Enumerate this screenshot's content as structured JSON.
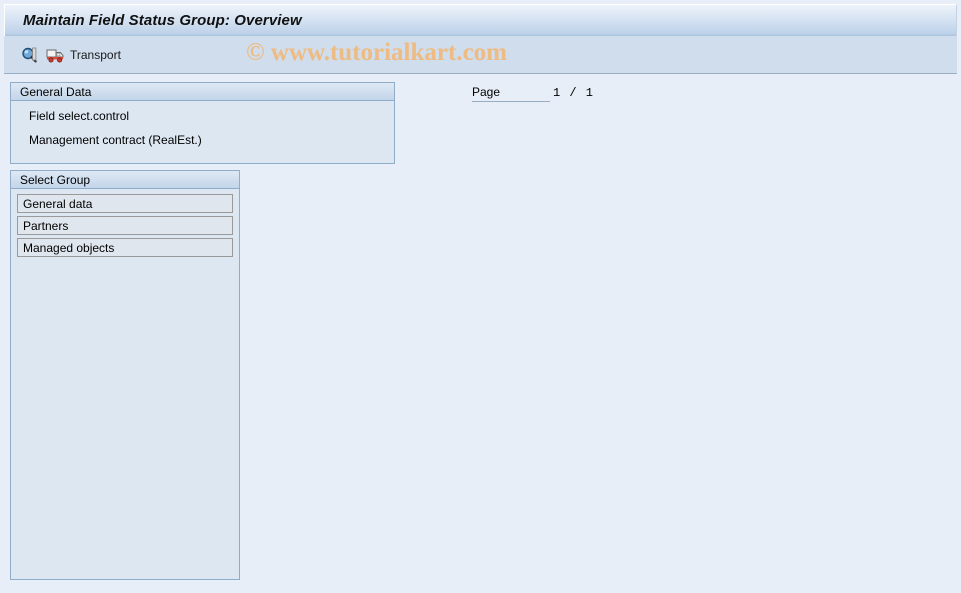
{
  "window": {
    "title": "Maintain Field Status Group: Overview"
  },
  "watermark": {
    "text": "© www.tutorialkart.com",
    "color": "#eebb82"
  },
  "toolbar": {
    "buttons": [
      {
        "name": "display-detail",
        "icon": "magnifier-icon",
        "label": ""
      },
      {
        "name": "transport",
        "icon": "truck-icon",
        "label": "Transport"
      }
    ]
  },
  "general_data": {
    "header": "General Data",
    "line1": "Field select.control",
    "line2": "Management contract (RealEst.)"
  },
  "page": {
    "label": "Page",
    "value": "1 / 1",
    "current": 1,
    "total": 1
  },
  "select_group": {
    "header": "Select Group",
    "items": [
      {
        "label": "General data"
      },
      {
        "label": "Partners"
      },
      {
        "label": "Managed objects"
      }
    ]
  },
  "colors": {
    "background": "#e8eef7",
    "titlebar_top": "#eef3fa",
    "titlebar_bottom": "#a9c2dd",
    "toolbar": "#cfdded",
    "panel_fill": "#dde7f2",
    "panel_border": "#8fadc9",
    "item_fill": "#dfe6ee",
    "item_border": "#9a9a9a"
  }
}
